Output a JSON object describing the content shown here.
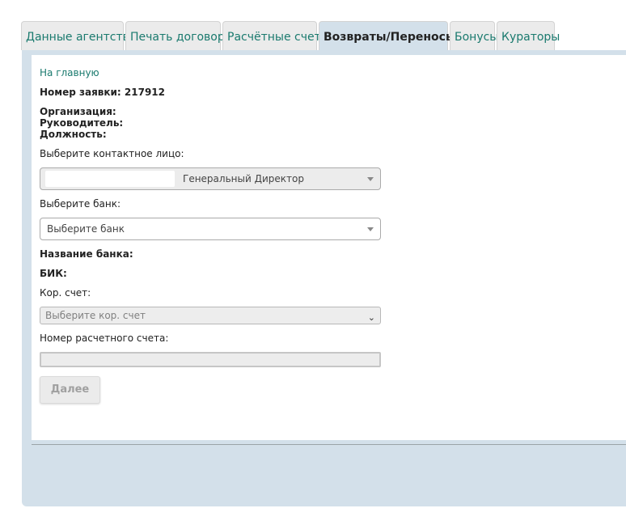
{
  "tabs": [
    {
      "label": "Данные агентства"
    },
    {
      "label": "Печать договора"
    },
    {
      "label": "Расчётные счета"
    },
    {
      "label": "Возвраты/Переносы"
    },
    {
      "label": "Бонусы"
    },
    {
      "label": "Кураторы"
    }
  ],
  "form": {
    "home_link": "На главную",
    "order_number": "Номер заявки: 217912",
    "organization": "Организация:",
    "director": "Руководитель:",
    "position": "Должность:",
    "contact_label": "Выберите контактное лицо:",
    "contact_value": "Генеральный Директор",
    "bank_label": "Выберите банк:",
    "bank_value": "Выберите банк",
    "bank_name": "Название банка:",
    "bik": "БИК:",
    "corr_label": "Кор. счет:",
    "corr_value": "Выберите кор. счет",
    "account_label": "Номер расчетного счета:",
    "next_button": "Далее"
  },
  "colors": {
    "accent": "#1a7a6e",
    "panel": "#d3e0ea",
    "tab_bg": "#ebebeb"
  }
}
